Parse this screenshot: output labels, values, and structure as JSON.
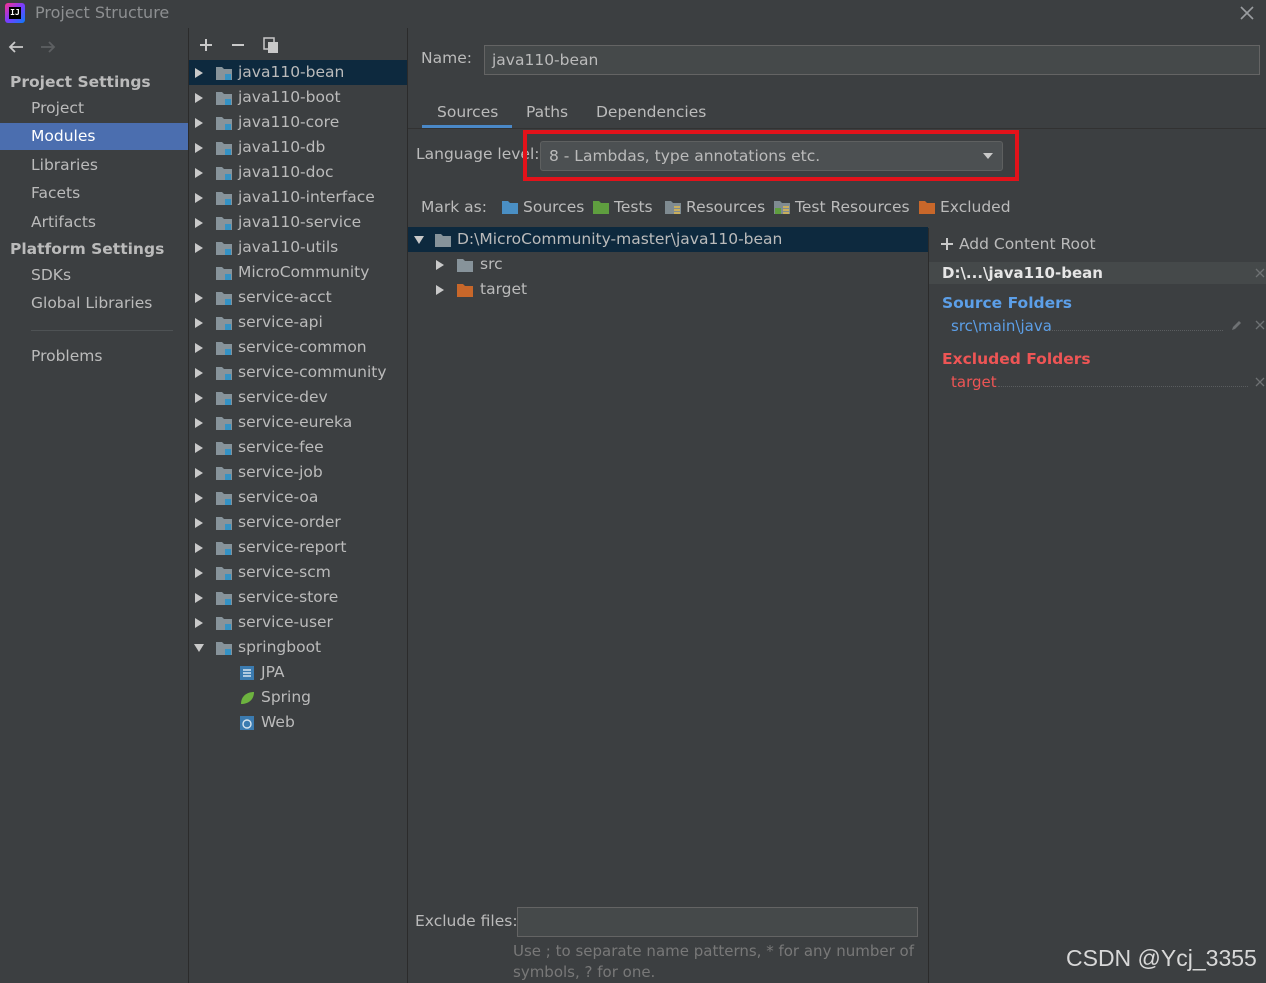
{
  "window": {
    "title": "Project Structure"
  },
  "nav": {
    "project_settings_header": "Project Settings",
    "platform_settings_header": "Platform Settings",
    "items": {
      "project": "Project",
      "modules": "Modules",
      "libraries": "Libraries",
      "facets": "Facets",
      "artifacts": "Artifacts",
      "sdks": "SDKs",
      "global_libraries": "Global Libraries",
      "problems": "Problems"
    }
  },
  "modules": {
    "items": [
      "java110-bean",
      "java110-boot",
      "java110-core",
      "java110-db",
      "java110-doc",
      "java110-interface",
      "java110-service",
      "java110-utils",
      "MicroCommunity",
      "service-acct",
      "service-api",
      "service-common",
      "service-community",
      "service-dev",
      "service-eureka",
      "service-fee",
      "service-job",
      "service-oa",
      "service-order",
      "service-report",
      "service-scm",
      "service-store",
      "service-user",
      "springboot"
    ],
    "facets": [
      "JPA",
      "Spring",
      "Web"
    ]
  },
  "details": {
    "name_label": "Name:",
    "name_value": "java110-bean",
    "tabs": {
      "sources": "Sources",
      "paths": "Paths",
      "dependencies": "Dependencies"
    },
    "language_level_label": "Language level:",
    "language_level_value": "8 - Lambdas, type annotations etc.",
    "mark_as_label": "Mark as:",
    "mark_as": {
      "sources": "Sources",
      "tests": "Tests",
      "resources": "Resources",
      "test_resources": "Test Resources",
      "excluded": "Excluded"
    },
    "content_tree": {
      "root": "D:\\MicroCommunity-master\\java110-bean",
      "src": "src",
      "target": "target"
    },
    "add_content_root": "Add Content Root",
    "root_header": "D:\\...\\java110-bean",
    "source_folders_title": "Source Folders",
    "source_folder_path": "src\\main\\java",
    "excluded_folders_title": "Excluded Folders",
    "excluded_folder_path": "target",
    "exclude_files_label": "Exclude files:",
    "exclude_files_value": "",
    "hint_line1": "Use ; to separate name patterns, * for any number of",
    "hint_line2": "symbols, ? for one."
  },
  "watermark": "CSDN @Ycj_3355",
  "colors": {
    "background": "#3c3f41",
    "selection": "#4b6eaf",
    "tree_selection": "#0d293e",
    "source": "#5c9fe8",
    "excluded": "#ee5555",
    "highlight": "#e3121a"
  }
}
